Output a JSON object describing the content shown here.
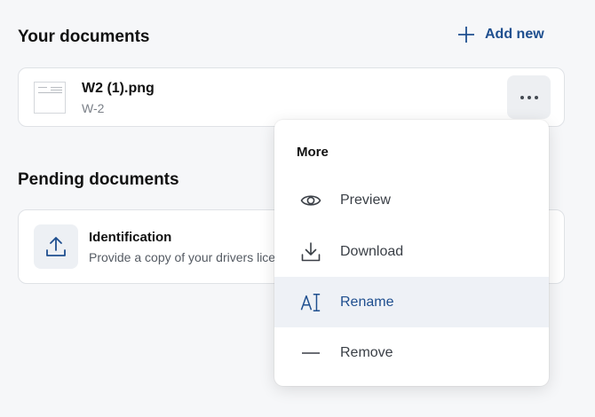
{
  "header": {
    "title": "Your documents",
    "add_new_label": "Add new"
  },
  "documents": [
    {
      "name": "W2 (1).png",
      "type": "W-2"
    }
  ],
  "pending": {
    "title": "Pending documents",
    "items": [
      {
        "title": "Identification",
        "description": "Provide a copy of your drivers lice"
      }
    ]
  },
  "menu": {
    "title": "More",
    "items": [
      {
        "label": "Preview",
        "icon": "eye-icon"
      },
      {
        "label": "Download",
        "icon": "download-icon"
      },
      {
        "label": "Rename",
        "icon": "rename-icon",
        "active": true
      },
      {
        "label": "Remove",
        "icon": "minus-icon"
      }
    ]
  },
  "colors": {
    "accent": "#1f4f8f",
    "background": "#f6f7f9",
    "active_row": "#eef1f6"
  }
}
